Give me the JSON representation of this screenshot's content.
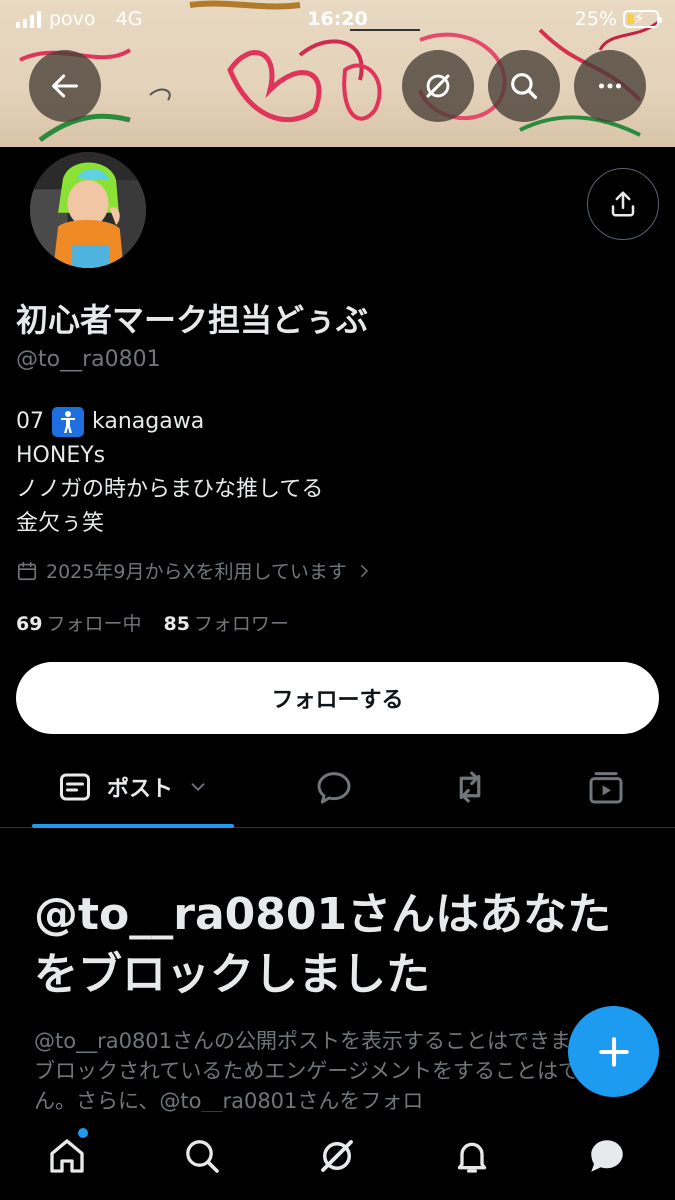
{
  "status_bar": {
    "carrier": "povo",
    "network": "4G",
    "time": "16:20",
    "battery_percent": "25%"
  },
  "header": {
    "back_icon": "arrow-left-icon",
    "grok_icon": "grok-icon",
    "search_icon": "search-icon",
    "more_icon": "more-icon"
  },
  "profile": {
    "display_name": "初心者マーク担当どぅぶ",
    "handle": "@to__ra0801",
    "bio": {
      "line1_prefix": "07",
      "line1_suffix": "kanagawa",
      "line2": "HONEYs",
      "line3": "ノノガの時からまひな推してる",
      "line4": "金欠ぅ笑"
    },
    "joined": "2025年9月からXを利用しています",
    "following_count": "69",
    "following_label": "フォロー中",
    "followers_count": "85",
    "followers_label": "フォロワー",
    "follow_button": "フォローする"
  },
  "tabs": {
    "posts_label": "ポスト"
  },
  "blocked": {
    "title": "@to__ra0801さんはあなたをブロックしました",
    "description": "@to__ra0801さんの公開ポストを表示することはできますが、ブロックされているためエンゲージメントをすることはできません。さらに、@to__ra0801さんをフォロ"
  },
  "colors": {
    "accent": "#1d9bf0",
    "background": "#000000",
    "text_primary": "#e7e9ea",
    "text_secondary": "#71767b"
  }
}
